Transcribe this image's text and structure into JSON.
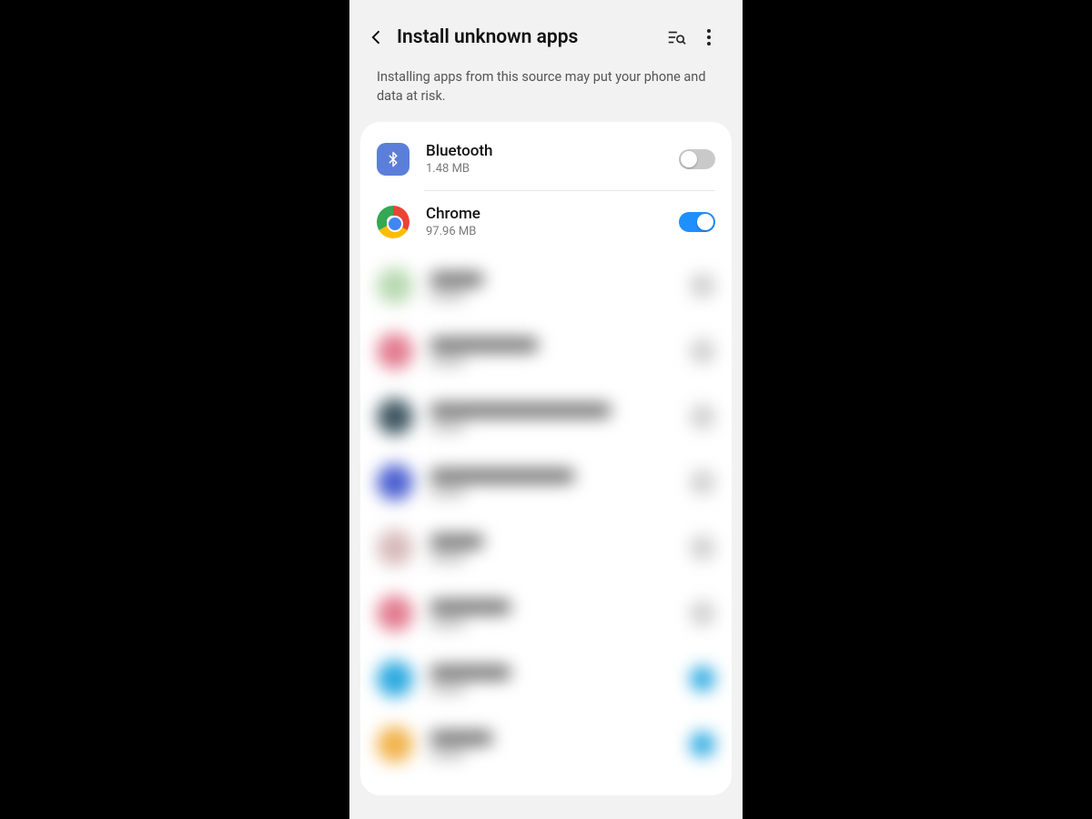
{
  "header": {
    "title": "Install unknown apps"
  },
  "warning_text": "Installing apps from this source may put your phone and data at risk.",
  "apps": [
    {
      "name": "Bluetooth",
      "size": "1.48 MB",
      "enabled": false,
      "icon": "bluetooth"
    },
    {
      "name": "Chrome",
      "size": "97.96 MB",
      "enabled": true,
      "icon": "chrome"
    }
  ],
  "blurred_rows": [
    {
      "icon_color": "#b8d9b0",
      "text_width": 60,
      "toggle_color": "#cfcfcf"
    },
    {
      "icon_color": "#e27b8f",
      "text_width": 120,
      "toggle_color": "#cfcfcf"
    },
    {
      "icon_color": "#3d5560",
      "text_width": 200,
      "toggle_color": "#cfcfcf"
    },
    {
      "icon_color": "#4a5fd0",
      "text_width": 160,
      "toggle_color": "#cfcfcf"
    },
    {
      "icon_color": "#d8baba",
      "text_width": 60,
      "toggle_color": "#cfcfcf"
    },
    {
      "icon_color": "#e27b8f",
      "text_width": 90,
      "toggle_color": "#cfcfcf"
    },
    {
      "icon_color": "#2aa9e0",
      "text_width": 90,
      "toggle_color": "#2aa9e0"
    },
    {
      "icon_color": "#f1b24a",
      "text_width": 70,
      "toggle_color": "#2aa9e0"
    }
  ]
}
